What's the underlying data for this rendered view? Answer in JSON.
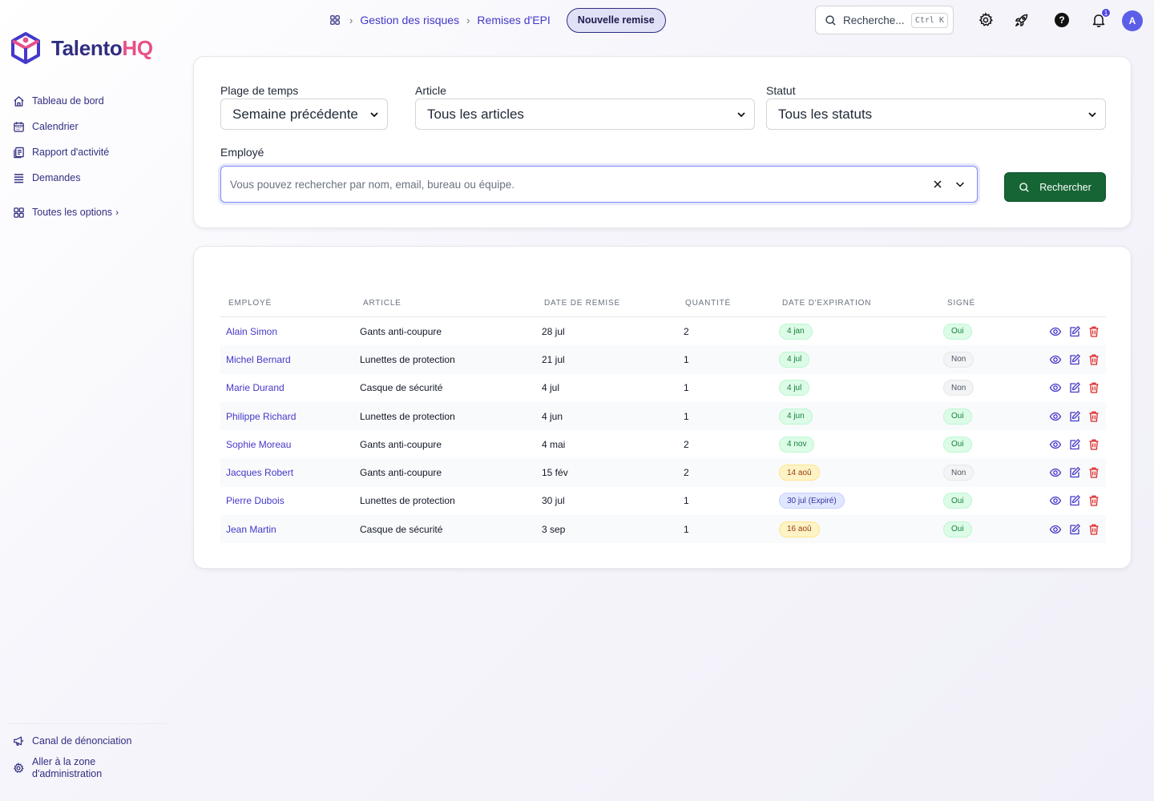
{
  "app": {
    "logo_main": "Talento",
    "logo_accent": "HQ",
    "brand_color": "#312e81",
    "accent_color": "#e8508a"
  },
  "sidebar": {
    "items": [
      {
        "label": "Tableau de bord",
        "icon": "home-icon"
      },
      {
        "label": "Calendrier",
        "icon": "calendar-icon"
      },
      {
        "label": "Rapport d'activité",
        "icon": "report-icon"
      },
      {
        "label": "Demandes",
        "icon": "list-icon"
      }
    ],
    "all_options": "Toutes les options",
    "bottom": {
      "whistleblow": "Canal de dénonciation",
      "admin": "Aller à la zone d'administration"
    }
  },
  "topbar": {
    "breadcrumb": [
      "Gestion des risques",
      "Remises d'EPI"
    ],
    "new_button": "Nouvelle remise",
    "search_placeholder": "Recherche...",
    "search_shortcut": "Ctrl K",
    "notification_count": "1",
    "avatar_initial": "A"
  },
  "filters": {
    "time_range_label": "Plage de temps",
    "time_range_value": "Semaine précédente",
    "article_label": "Article",
    "article_value": "Tous les articles",
    "status_label": "Statut",
    "status_value": "Tous les statuts",
    "employee_label": "Employé",
    "employee_placeholder": "Vous pouvez rechercher par nom, email, bureau ou équipe.",
    "search_button": "Rechercher"
  },
  "table": {
    "headers": [
      "EMPLOYÉ",
      "ARTICLE",
      "DATE DE REMISE",
      "QUANTITÉ",
      "DATE D'EXPIRATION",
      "SIGNÉ"
    ],
    "rows": [
      {
        "employee": "Alain Simon",
        "article": "Gants anti-coupure",
        "date": "28 jul",
        "qty": "2",
        "expiry": "4 jan",
        "expiry_status": "green",
        "signed": "Oui"
      },
      {
        "employee": "Michel Bernard",
        "article": "Lunettes de protection",
        "date": "21 jul",
        "qty": "1",
        "expiry": "4 jul",
        "expiry_status": "green",
        "signed": "Non"
      },
      {
        "employee": "Marie Durand",
        "article": "Casque de sécurité",
        "date": "4 jul",
        "qty": "1",
        "expiry": "4 jul",
        "expiry_status": "green",
        "signed": "Non"
      },
      {
        "employee": "Philippe Richard",
        "article": "Lunettes de protection",
        "date": "4 jun",
        "qty": "1",
        "expiry": "4 jun",
        "expiry_status": "green",
        "signed": "Oui"
      },
      {
        "employee": "Sophie Moreau",
        "article": "Gants anti-coupure",
        "date": "4 mai",
        "qty": "2",
        "expiry": "4 nov",
        "expiry_status": "green",
        "signed": "Oui"
      },
      {
        "employee": "Jacques Robert",
        "article": "Gants anti-coupure",
        "date": "15 fév",
        "qty": "2",
        "expiry": "14 aoû",
        "expiry_status": "yellow",
        "signed": "Non"
      },
      {
        "employee": "Pierre Dubois",
        "article": "Lunettes de protection",
        "date": "30 jul",
        "qty": "1",
        "expiry": "30 jul (Expiré)",
        "expiry_status": "blue",
        "signed": "Oui"
      },
      {
        "employee": "Jean Martin",
        "article": "Casque de sécurité",
        "date": "3 sep",
        "qty": "1",
        "expiry": "16 aoû",
        "expiry_status": "yellow",
        "signed": "Oui"
      }
    ]
  }
}
